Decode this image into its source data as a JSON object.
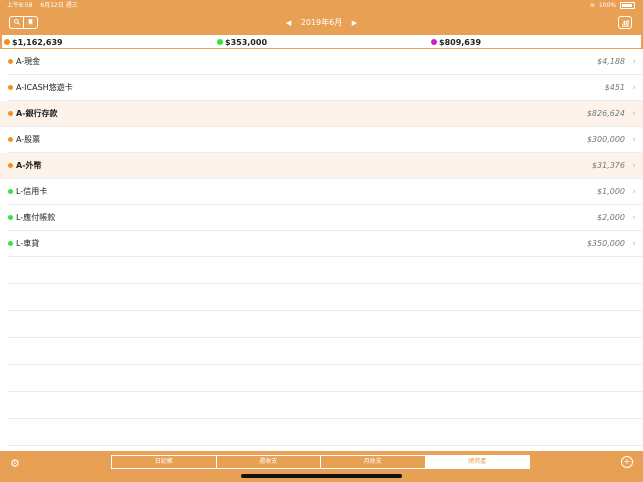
{
  "status": {
    "time": "上午8:58",
    "date": "6月12日 週三",
    "battery": "100%"
  },
  "nav": {
    "title": "2019年6月",
    "prev_arrow": "◀",
    "next_arrow": "▶",
    "search_icon": "search-icon",
    "bookmark_icon": "bookmark-icon",
    "chart_icon": "chart-icon"
  },
  "summary": {
    "total": {
      "value": "$1,162,639",
      "color": "#f0931e"
    },
    "liability": {
      "value": "$353,000",
      "color": "#36e33a"
    },
    "net": {
      "value": "$809,639",
      "color": "#c522c8"
    }
  },
  "accounts": [
    {
      "name": "A-現金",
      "amount": "$4,188",
      "color": "#f0931e",
      "highlight": false
    },
    {
      "name": "A-ICASH悠遊卡",
      "amount": "$451",
      "color": "#f0931e",
      "highlight": false
    },
    {
      "name": "A-銀行存款",
      "amount": "$826,624",
      "color": "#f0931e",
      "highlight": true
    },
    {
      "name": "A-股票",
      "amount": "$300,000",
      "color": "#f0931e",
      "highlight": false
    },
    {
      "name": "A-外幣",
      "amount": "$31,376",
      "color": "#f0931e",
      "highlight": true
    },
    {
      "name": "L-信用卡",
      "amount": "$1,000",
      "color": "#36e33a",
      "highlight": false
    },
    {
      "name": "L-應付帳款",
      "amount": "$2,000",
      "color": "#36e33a",
      "highlight": false
    },
    {
      "name": "L-車貸",
      "amount": "$350,000",
      "color": "#36e33a",
      "highlight": false
    }
  ],
  "tabs": [
    {
      "label": "日記帳",
      "active": false
    },
    {
      "label": "週收支",
      "active": false
    },
    {
      "label": "月收支",
      "active": false
    },
    {
      "label": "總資產",
      "active": true
    }
  ],
  "accent": "#e8a154"
}
